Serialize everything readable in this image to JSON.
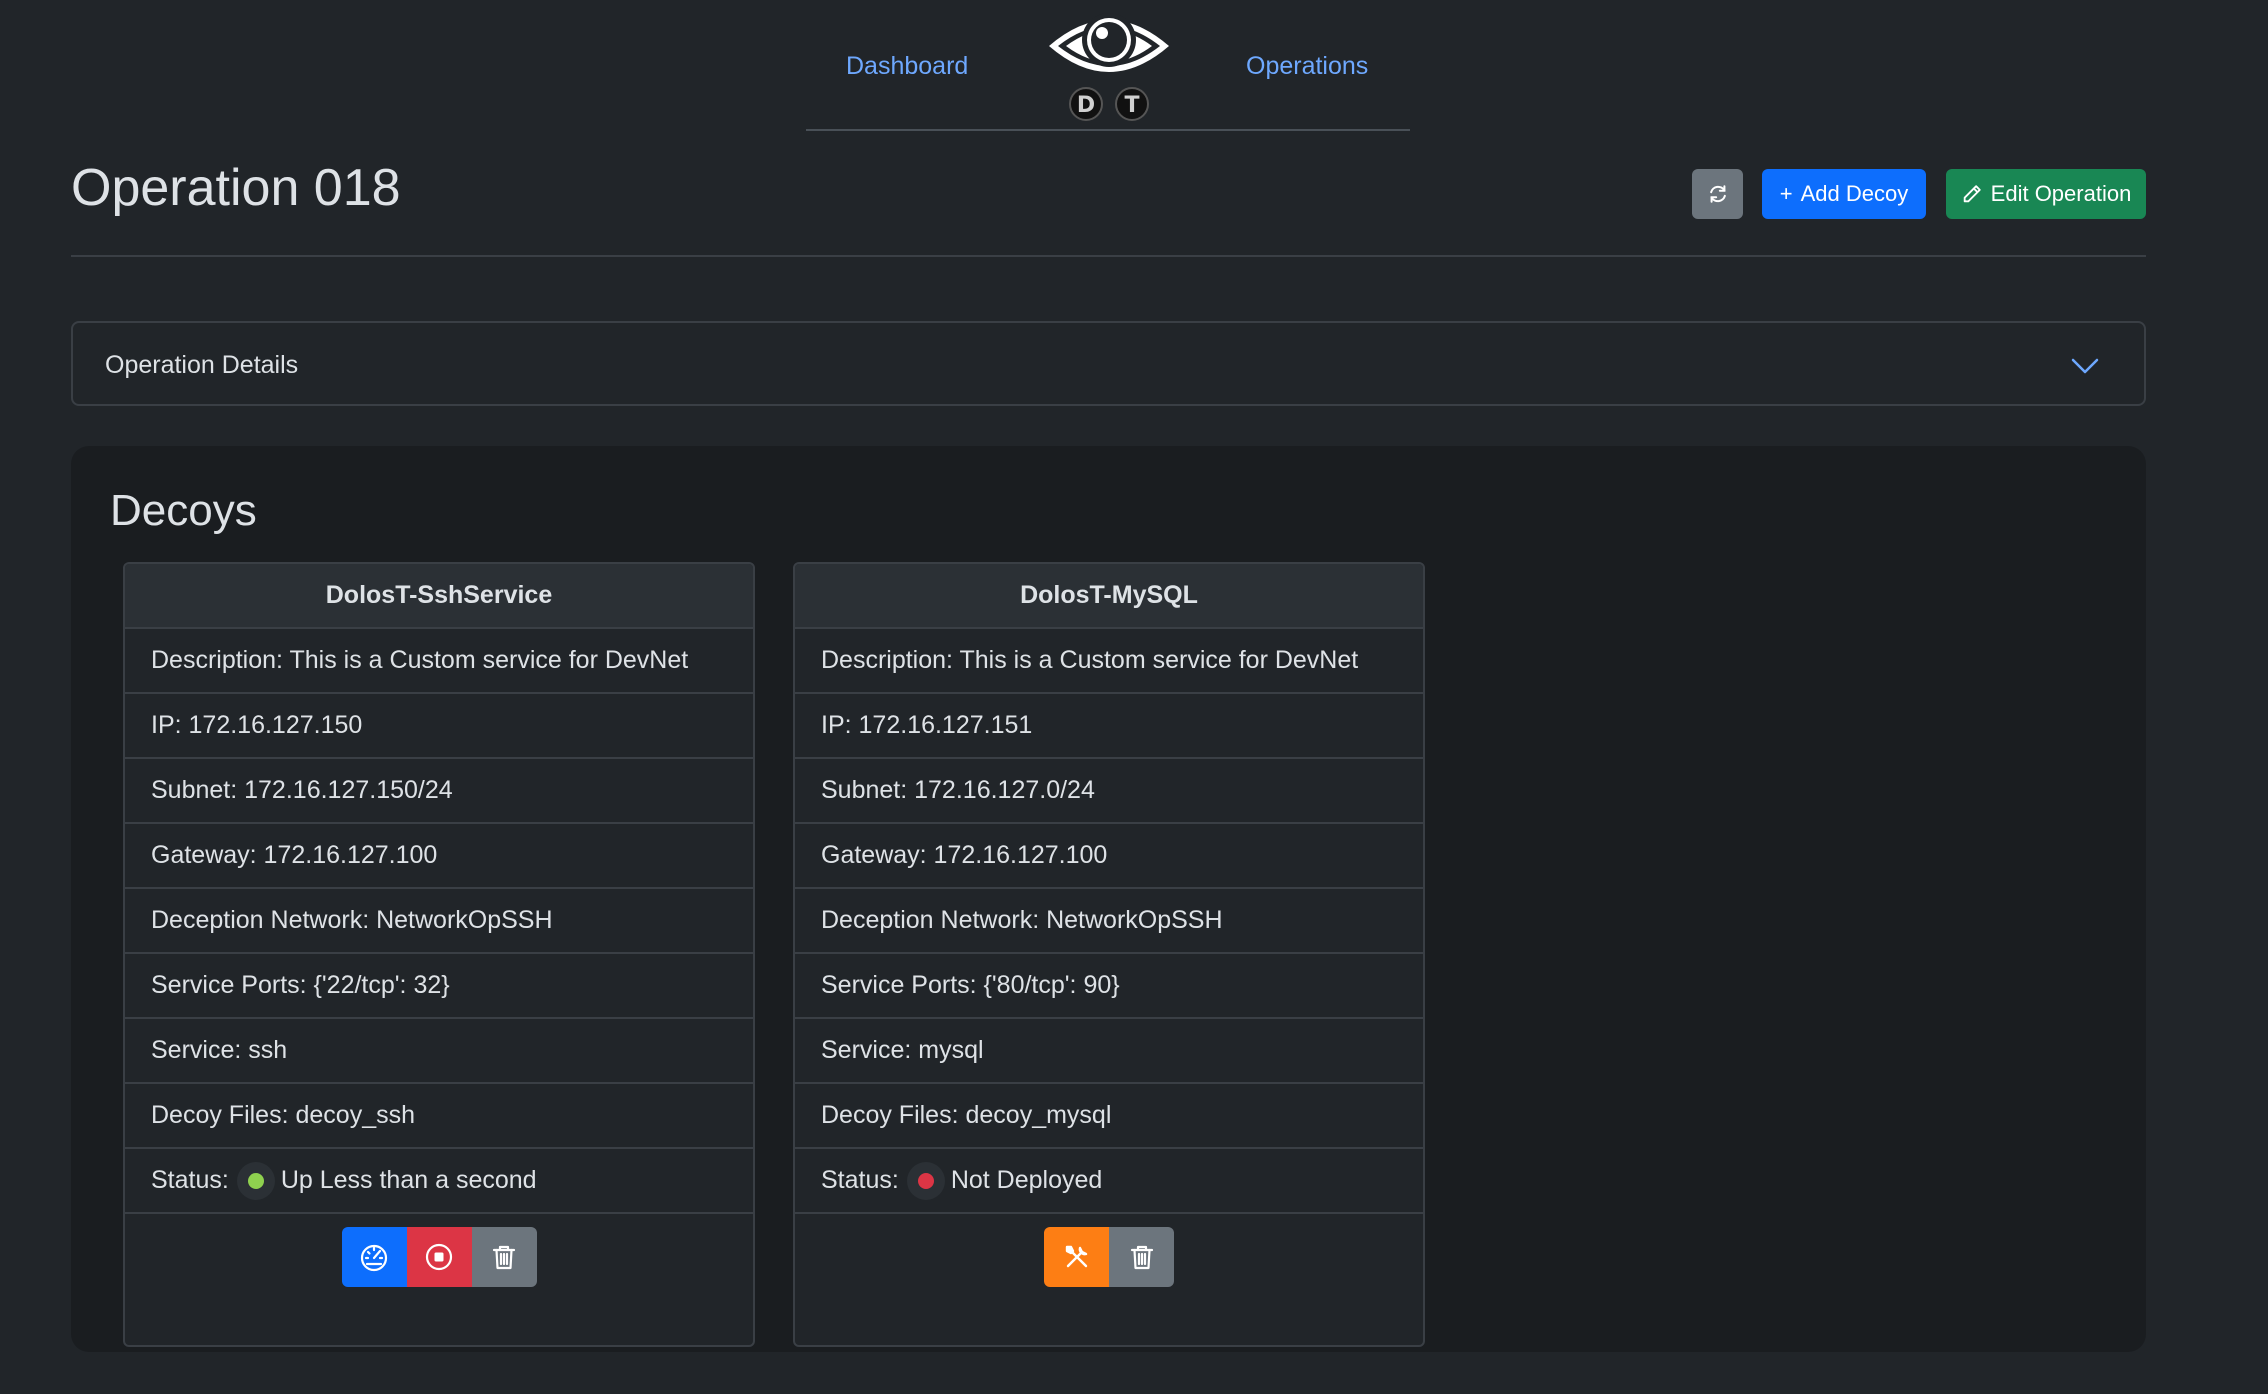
{
  "nav": {
    "dashboard_label": "Dashboard",
    "operations_label": "Operations",
    "logo_letters": "DT"
  },
  "header": {
    "title": "Operation 018",
    "add_decoy_label": "Add Decoy",
    "edit_operation_label": "Edit Operation",
    "add_icon": "+"
  },
  "accordion": {
    "label": "Operation Details"
  },
  "decoys": {
    "title": "Decoys",
    "cards": [
      {
        "name": "DolosT-SshService",
        "description": "Description: This is a Custom service for DevNet",
        "ip": "IP: 172.16.127.150",
        "subnet": "Subnet: 172.16.127.150/24",
        "gateway": "Gateway: 172.16.127.100",
        "network": "Deception Network: NetworkOpSSH",
        "ports": "Service Ports: {'22/tcp': 32}",
        "service": "Service: ssh",
        "files": "Decoy Files: decoy_ssh",
        "status_label": "Status:",
        "status_text": "Up Less than a second",
        "status_color": "#8fd14f",
        "actions": [
          "dashboard-icon",
          "stop-icon",
          "trash-icon"
        ]
      },
      {
        "name": "DolosT-MySQL",
        "description": "Description: This is a Custom service for DevNet",
        "ip": "IP: 172.16.127.151",
        "subnet": "Subnet: 172.16.127.0/24",
        "gateway": "Gateway: 172.16.127.100",
        "network": "Deception Network: NetworkOpSSH",
        "ports": "Service Ports: {'80/tcp': 90}",
        "service": "Service: mysql",
        "files": "Decoy Files: decoy_mysql",
        "status_label": "Status:",
        "status_text": "Not Deployed",
        "status_color": "#dc3545",
        "actions": [
          "tools-icon",
          "trash-icon"
        ]
      }
    ]
  },
  "colors": {
    "primary": "#0d6efd",
    "success": "#198754",
    "danger": "#dc3545",
    "secondary": "#6c757d",
    "warning": "#fd7e14",
    "link": "#6ea8fe"
  }
}
